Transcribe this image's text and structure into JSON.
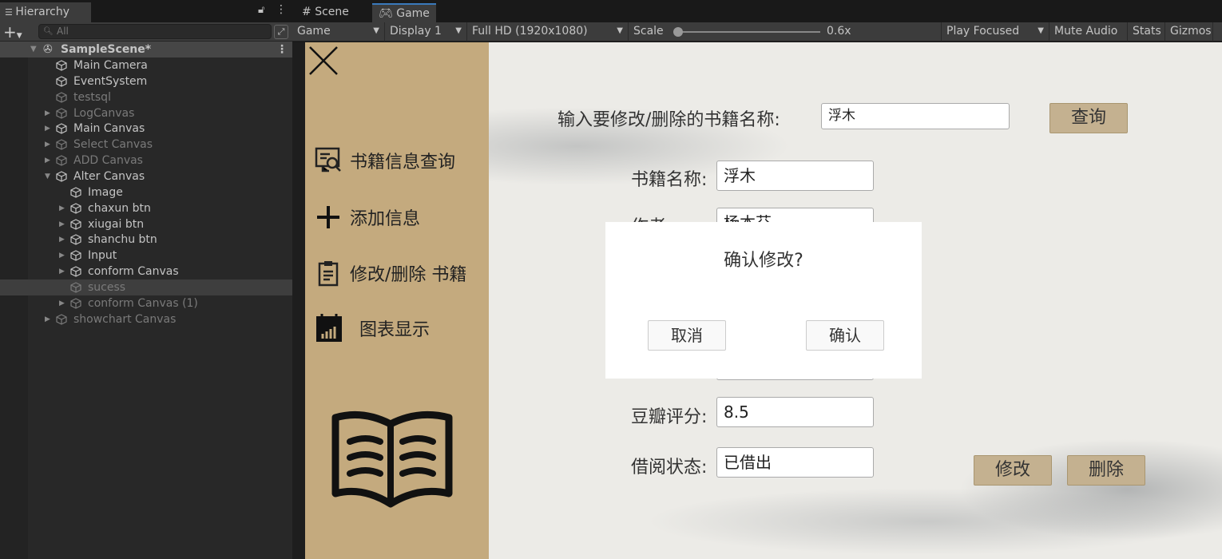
{
  "hierarchy": {
    "title": "Hierarchy",
    "search_placeholder": "All",
    "scene": "SampleScene*",
    "items": [
      {
        "label": "Main Camera",
        "depth": 1,
        "dim": false,
        "arrow": ""
      },
      {
        "label": "EventSystem",
        "depth": 1,
        "dim": false,
        "arrow": ""
      },
      {
        "label": "testsql",
        "depth": 1,
        "dim": true,
        "arrow": ""
      },
      {
        "label": "LogCanvas",
        "depth": 1,
        "dim": true,
        "arrow": "▶"
      },
      {
        "label": "Main Canvas",
        "depth": 1,
        "dim": false,
        "arrow": "▶"
      },
      {
        "label": "Select Canvas",
        "depth": 1,
        "dim": true,
        "arrow": "▶"
      },
      {
        "label": "ADD Canvas",
        "depth": 1,
        "dim": true,
        "arrow": "▶"
      },
      {
        "label": "Alter Canvas",
        "depth": 1,
        "dim": false,
        "arrow": "▼"
      },
      {
        "label": "Image",
        "depth": 2,
        "dim": false,
        "arrow": ""
      },
      {
        "label": "chaxun btn",
        "depth": 2,
        "dim": false,
        "arrow": "▶"
      },
      {
        "label": "xiugai btn",
        "depth": 2,
        "dim": false,
        "arrow": "▶"
      },
      {
        "label": "shanchu btn",
        "depth": 2,
        "dim": false,
        "arrow": "▶"
      },
      {
        "label": "Input",
        "depth": 2,
        "dim": false,
        "arrow": "▶"
      },
      {
        "label": "conform Canvas",
        "depth": 2,
        "dim": false,
        "arrow": "▶"
      },
      {
        "label": "sucess",
        "depth": 2,
        "dim": true,
        "arrow": "",
        "selected": true
      },
      {
        "label": "conform Canvas (1)",
        "depth": 2,
        "dim": true,
        "arrow": "▶"
      },
      {
        "label": "showchart Canvas",
        "depth": 1,
        "dim": true,
        "arrow": "▶"
      }
    ]
  },
  "game_view": {
    "tabs": [
      "Scene",
      "Game"
    ],
    "toolbar": {
      "mode": "Game",
      "display": "Display 1",
      "resolution": "Full HD (1920x1080)",
      "scale_label": "Scale",
      "scale_value": "0.6x",
      "play_mode": "Play Focused",
      "mute": "Mute Audio",
      "stats": "Stats",
      "gizmos": "Gizmos"
    }
  },
  "app": {
    "nav": [
      "书籍信息查询",
      "添加信息",
      "修改/删除 书籍",
      "图表显示"
    ],
    "query_label": "输入要修改/删除的书籍名称:",
    "query_value": "浮木",
    "query_button": "查询",
    "fields": [
      {
        "label": "书籍名称:",
        "value": "浮木"
      },
      {
        "label": "作者:",
        "value": "杨本芬"
      },
      {
        "label": "豆瓣评分:",
        "value": "8.5"
      },
      {
        "label": "借阅状态:",
        "value": "已借出"
      }
    ],
    "modify_button": "修改",
    "delete_button": "删除",
    "dialog": {
      "title": "确认修改?",
      "cancel": "取消",
      "confirm": "确认"
    }
  }
}
